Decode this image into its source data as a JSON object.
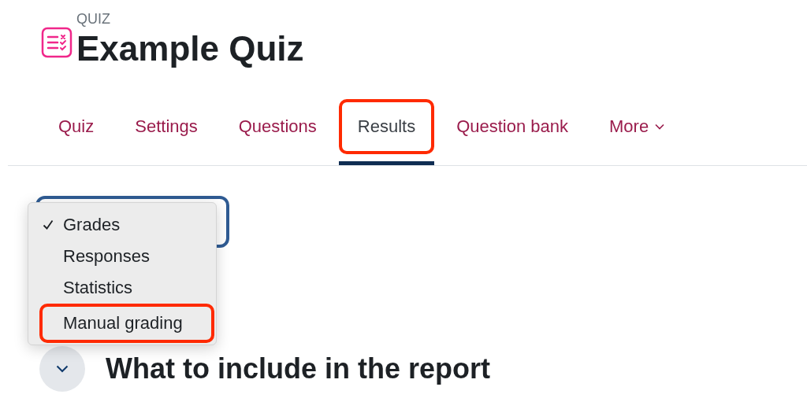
{
  "header": {
    "module_label": "QUIZ",
    "title": "Example Quiz"
  },
  "tabs": [
    {
      "label": "Quiz",
      "kind": "link",
      "selected": false,
      "highlighted": false
    },
    {
      "label": "Settings",
      "kind": "link",
      "selected": false,
      "highlighted": false
    },
    {
      "label": "Questions",
      "kind": "link",
      "selected": false,
      "highlighted": false
    },
    {
      "label": "Results",
      "kind": "link",
      "selected": true,
      "highlighted": true
    },
    {
      "label": "Question bank",
      "kind": "link",
      "selected": false,
      "highlighted": false
    },
    {
      "label": "More",
      "kind": "menu",
      "selected": false,
      "highlighted": false
    }
  ],
  "report_menu": {
    "items": [
      {
        "label": "Grades",
        "checked": true,
        "highlighted": false
      },
      {
        "label": "Responses",
        "checked": false,
        "highlighted": false
      },
      {
        "label": "Statistics",
        "checked": false,
        "highlighted": false
      },
      {
        "label": "Manual grading",
        "checked": false,
        "highlighted": true
      }
    ]
  },
  "section": {
    "heading": "What to include in the report"
  }
}
